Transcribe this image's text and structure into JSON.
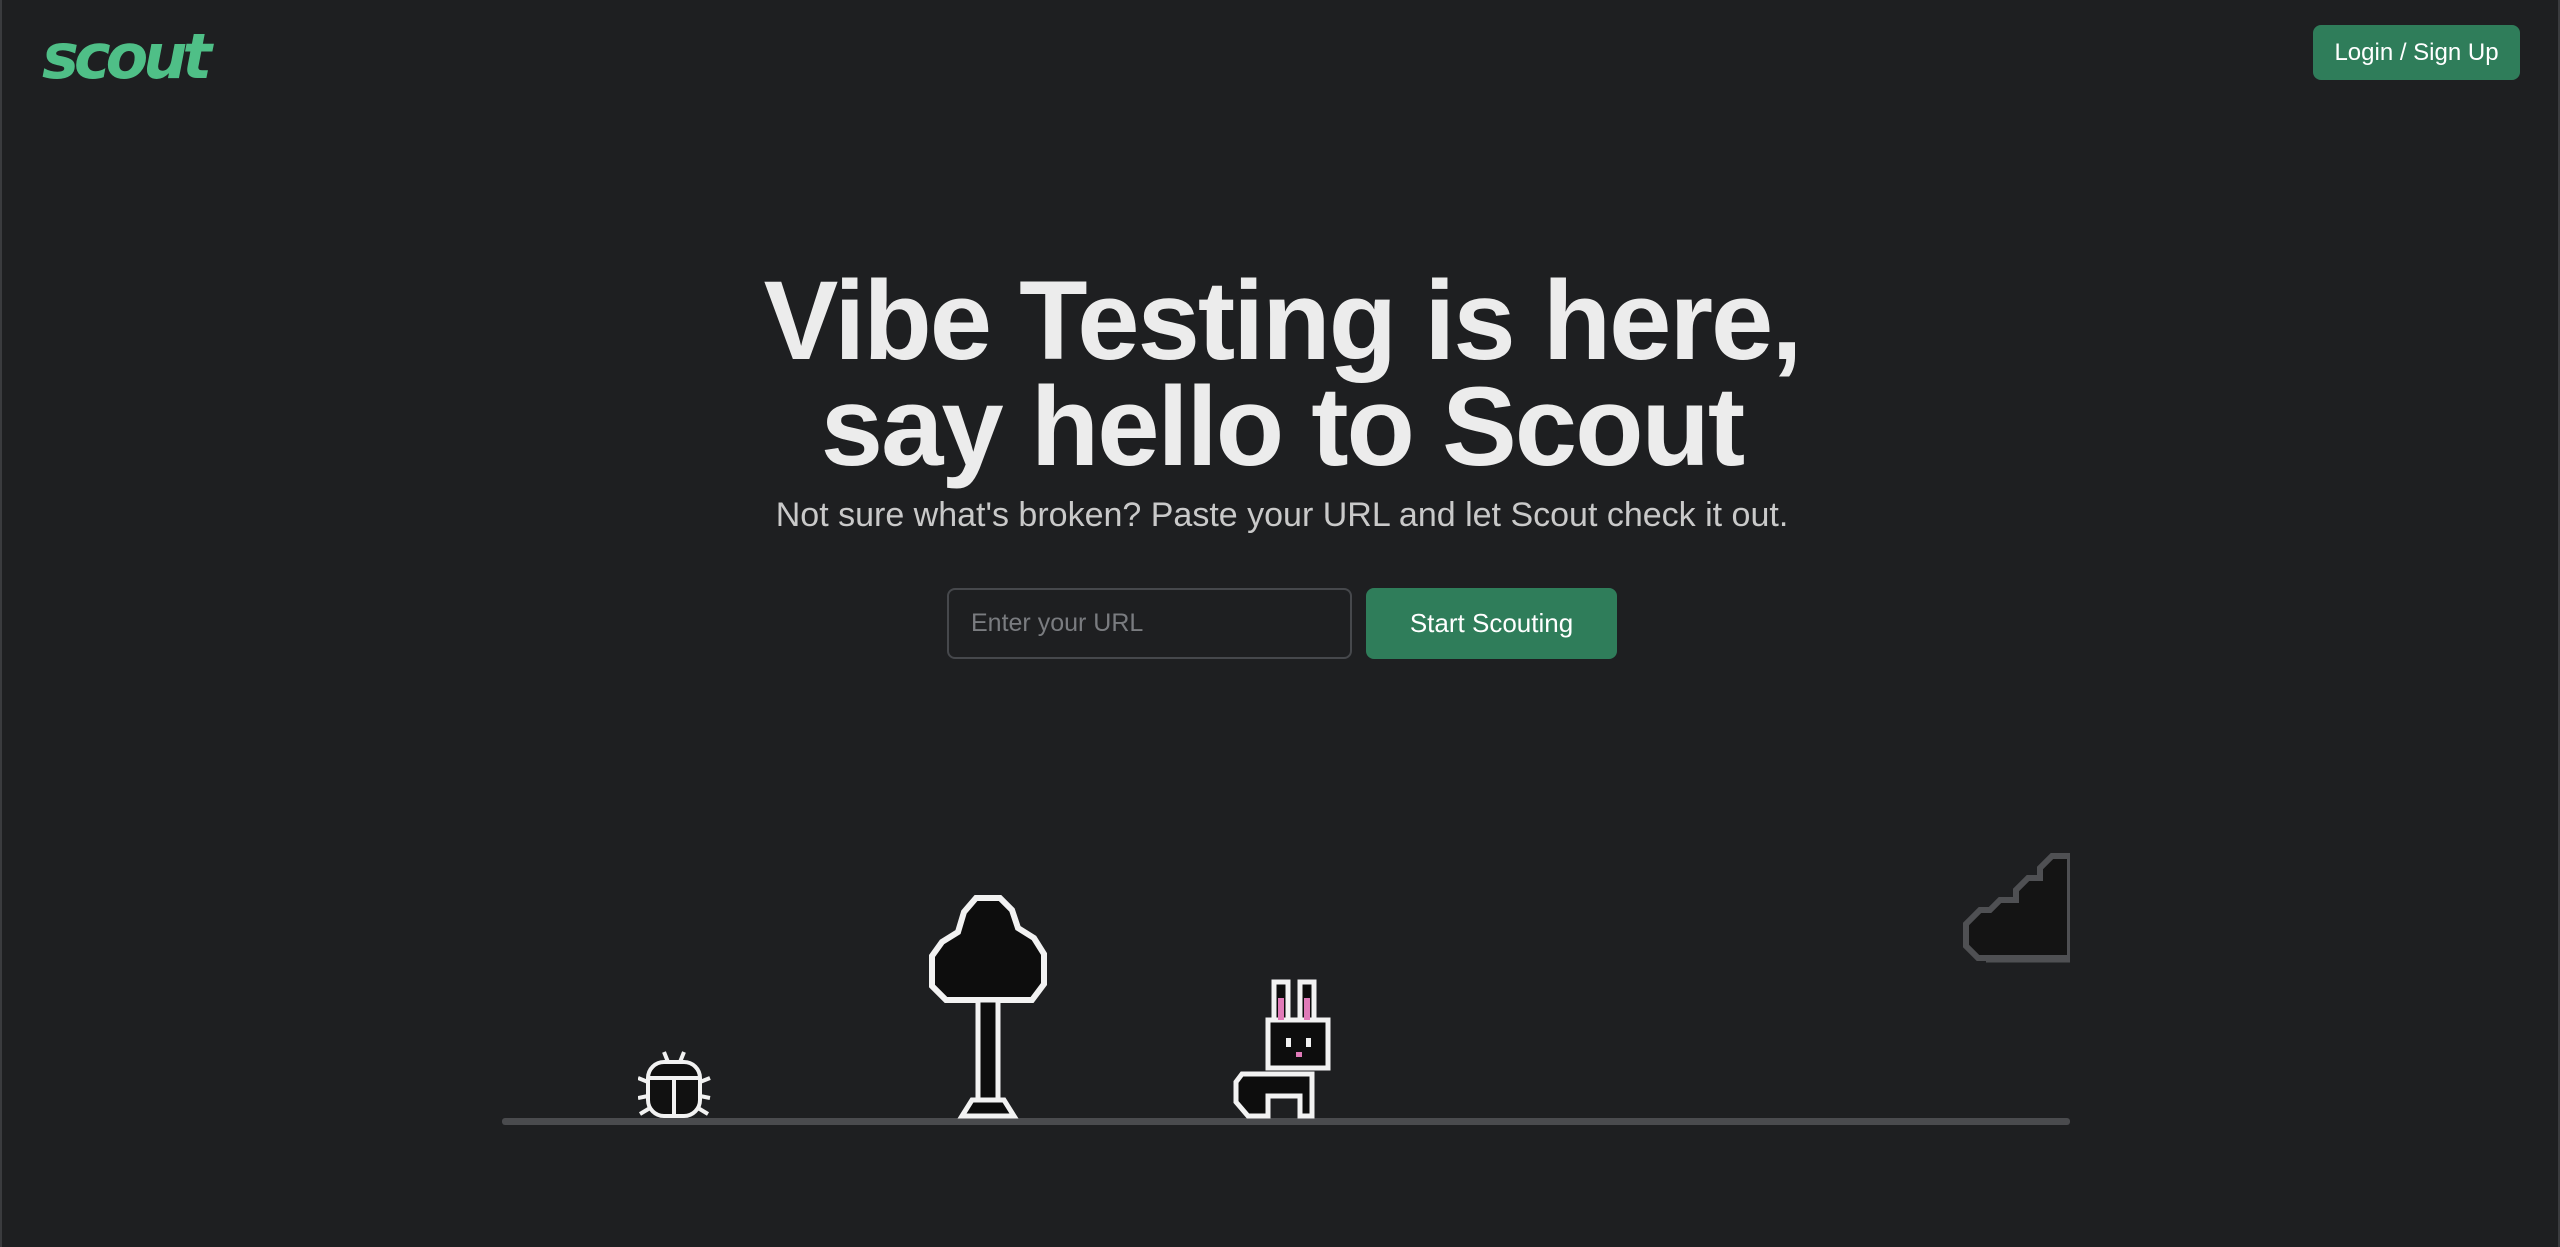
{
  "header": {
    "logo_text": "scout",
    "login_label": "Login / Sign Up"
  },
  "hero": {
    "headline_line1": "Vibe Testing is here,",
    "headline_line2": "say hello to Scout",
    "subtitle": "Not sure what's broken? Paste your URL and let Scout check it out.",
    "url_placeholder": "Enter your URL",
    "url_value": "",
    "start_label": "Start Scouting"
  },
  "scene": {
    "sprites": [
      "beetle-sprite",
      "tree-sprite",
      "bunny-sprite",
      "cloud-sprite"
    ],
    "ground": "ground-line"
  },
  "colors": {
    "background": "#1e1f21",
    "brand_green": "#2f7d5a",
    "logo_green": "#4fbf87",
    "text": "#ececec"
  }
}
